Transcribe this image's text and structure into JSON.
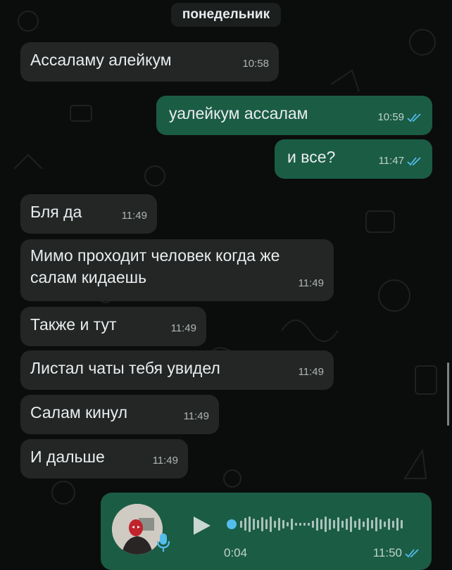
{
  "chat": {
    "day_label": "понедельник",
    "messages": [
      {
        "text": "Ассаламу алейкум",
        "time": "10:58"
      },
      {
        "text": "уалейкум ассалам",
        "time": "10:59"
      },
      {
        "text": "и все?",
        "time": "11:47"
      },
      {
        "text": "Бля да",
        "time": "11:49"
      },
      {
        "text": "Мимо проходит человек когда же салам кидаешь",
        "time": "11:49"
      },
      {
        "text": "Также и тут",
        "time": "11:49"
      },
      {
        "text": "Листал чаты тебя увидел",
        "time": "11:49"
      },
      {
        "text": "Салам кинул",
        "time": "11:49"
      },
      {
        "text": "И дальше",
        "time": "11:49"
      }
    ],
    "voice": {
      "duration": "0:04",
      "time": "11:50"
    }
  },
  "colors": {
    "background": "#0b0d0c",
    "incoming_bubble": "#232625",
    "outgoing_bubble": "#1b5c45",
    "read_ticks": "#53bdeb"
  },
  "icons": [
    "double-check-icon",
    "play-icon",
    "microphone-icon",
    "avatar"
  ]
}
